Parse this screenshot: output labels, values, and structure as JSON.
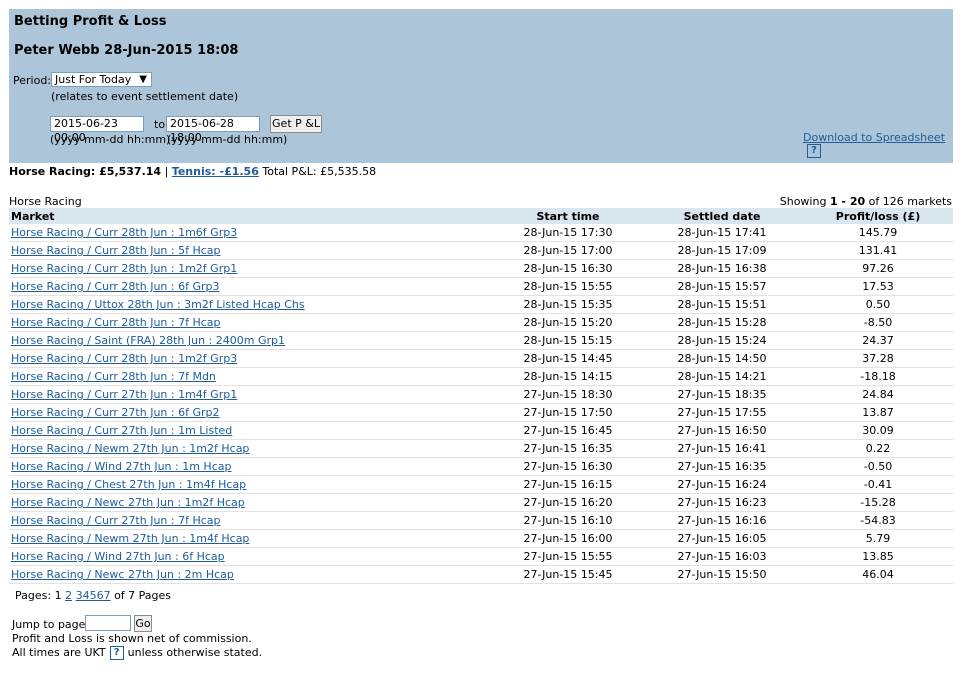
{
  "header": {
    "title": "Betting Profit & Loss",
    "subtitle": "Peter Webb 28-Jun-2015 18:08",
    "period_label": "Period:",
    "period_value": "Just For Today",
    "period_note": "(relates to event settlement date)",
    "date_from": "2015-06-23 00:00",
    "to_label": "to",
    "date_to": "2015-06-28 18:00",
    "get_button": "Get P &L",
    "format_from": "(yyyy-mm-dd hh:mm)",
    "format_to": "(yyyy-mm-dd hh:mm)",
    "download_label": "Download to Spreadsheet",
    "help_glyph": "?"
  },
  "summary": {
    "horse_label": "Horse Racing: £5,537.14",
    "separator": "|",
    "tennis_label": "Tennis: -£1.56",
    "total_label": "Total P&L:",
    "total_value": "£5,535.58"
  },
  "section_label": "Horse Racing",
  "showing": {
    "prefix": "Showing",
    "range": "1 - 20",
    "suffix": "of 126 markets"
  },
  "columns": {
    "market": "Market",
    "start": "Start time",
    "settled": "Settled date",
    "pl": "Profit/loss (£)"
  },
  "rows": [
    {
      "market": "Horse Racing / Curr 28th Jun : 1m6f Grp3",
      "start": "28-Jun-15 17:30",
      "settled": "28-Jun-15 17:41",
      "pl": "145.79"
    },
    {
      "market": "Horse Racing / Curr 28th Jun : 5f Hcap",
      "start": "28-Jun-15 17:00",
      "settled": "28-Jun-15 17:09",
      "pl": "131.41"
    },
    {
      "market": "Horse Racing / Curr 28th Jun : 1m2f Grp1",
      "start": "28-Jun-15 16:30",
      "settled": "28-Jun-15 16:38",
      "pl": "97.26"
    },
    {
      "market": "Horse Racing / Curr 28th Jun : 6f Grp3",
      "start": "28-Jun-15 15:55",
      "settled": "28-Jun-15 15:57",
      "pl": "17.53"
    },
    {
      "market": "Horse Racing / Uttox 28th Jun : 3m2f Listed Hcap Chs",
      "start": "28-Jun-15 15:35",
      "settled": "28-Jun-15 15:51",
      "pl": "0.50"
    },
    {
      "market": "Horse Racing / Curr 28th Jun : 7f Hcap",
      "start": "28-Jun-15 15:20",
      "settled": "28-Jun-15 15:28",
      "pl": "-8.50"
    },
    {
      "market": "Horse Racing / Saint (FRA) 28th Jun : 2400m Grp1",
      "start": "28-Jun-15 15:15",
      "settled": "28-Jun-15 15:24",
      "pl": "24.37"
    },
    {
      "market": "Horse Racing / Curr 28th Jun : 1m2f Grp3",
      "start": "28-Jun-15 14:45",
      "settled": "28-Jun-15 14:50",
      "pl": "37.28"
    },
    {
      "market": "Horse Racing / Curr 28th Jun : 7f Mdn",
      "start": "28-Jun-15 14:15",
      "settled": "28-Jun-15 14:21",
      "pl": "-18.18"
    },
    {
      "market": "Horse Racing / Curr 27th Jun : 1m4f Grp1",
      "start": "27-Jun-15 18:30",
      "settled": "27-Jun-15 18:35",
      "pl": "24.84"
    },
    {
      "market": "Horse Racing / Curr 27th Jun : 6f Grp2",
      "start": "27-Jun-15 17:50",
      "settled": "27-Jun-15 17:55",
      "pl": "13.87"
    },
    {
      "market": "Horse Racing / Curr 27th Jun : 1m Listed",
      "start": "27-Jun-15 16:45",
      "settled": "27-Jun-15 16:50",
      "pl": "30.09"
    },
    {
      "market": "Horse Racing / Newm 27th Jun : 1m2f Hcap",
      "start": "27-Jun-15 16:35",
      "settled": "27-Jun-15 16:41",
      "pl": "0.22"
    },
    {
      "market": "Horse Racing / Wind 27th Jun : 1m Hcap",
      "start": "27-Jun-15 16:30",
      "settled": "27-Jun-15 16:35",
      "pl": "-0.50"
    },
    {
      "market": "Horse Racing / Chest 27th Jun : 1m4f Hcap",
      "start": "27-Jun-15 16:15",
      "settled": "27-Jun-15 16:24",
      "pl": "-0.41"
    },
    {
      "market": "Horse Racing / Newc 27th Jun : 1m2f Hcap",
      "start": "27-Jun-15 16:20",
      "settled": "27-Jun-15 16:23",
      "pl": "-15.28"
    },
    {
      "market": "Horse Racing / Curr 27th Jun : 7f Hcap",
      "start": "27-Jun-15 16:10",
      "settled": "27-Jun-15 16:16",
      "pl": "-54.83"
    },
    {
      "market": "Horse Racing / Newm 27th Jun : 1m4f Hcap",
      "start": "27-Jun-15 16:00",
      "settled": "27-Jun-15 16:05",
      "pl": "5.79"
    },
    {
      "market": "Horse Racing / Wind 27th Jun : 6f Hcap",
      "start": "27-Jun-15 15:55",
      "settled": "27-Jun-15 16:03",
      "pl": "13.85"
    },
    {
      "market": "Horse Racing / Newc 27th Jun : 2m Hcap",
      "start": "27-Jun-15 15:45",
      "settled": "27-Jun-15 15:50",
      "pl": "46.04"
    }
  ],
  "pagination": {
    "label": "Pages:",
    "current": "1",
    "pages": [
      "2",
      "3",
      "4",
      "5",
      "6",
      "7"
    ],
    "suffix": "of 7 Pages"
  },
  "footer": {
    "jump_label": "Jump to page:",
    "go_label": "Go",
    "note_commission": "Profit and Loss is shown net of commission.",
    "note_times_prefix": "All times are UKT",
    "note_times_suffix": "unless otherwise stated."
  }
}
